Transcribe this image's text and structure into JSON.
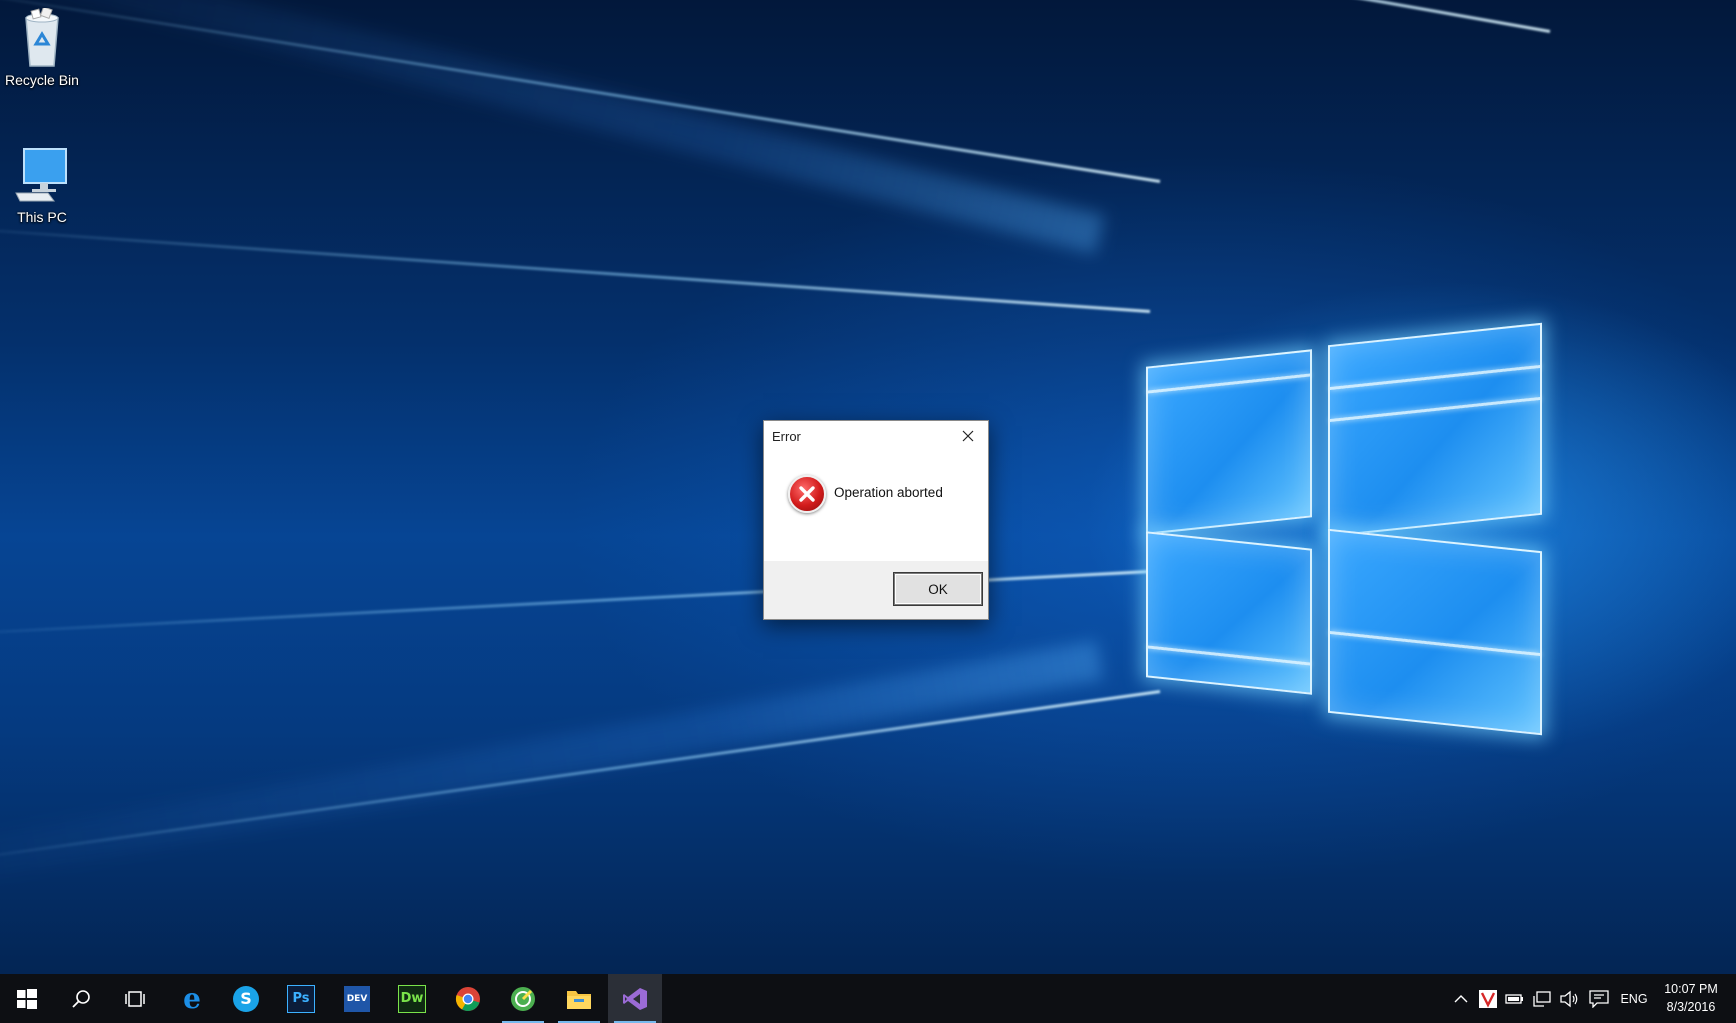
{
  "desktop": {
    "icons": [
      {
        "label": "Recycle Bin",
        "icon": "recycle-bin-icon"
      },
      {
        "label": "This PC",
        "icon": "this-pc-icon"
      }
    ]
  },
  "dialog": {
    "title": "Error",
    "message": "Operation aborted",
    "ok_label": "OK",
    "icon": "error-icon"
  },
  "taskbar": {
    "pinned_apps": [
      {
        "name": "start",
        "icon": "windows-start-icon"
      },
      {
        "name": "search",
        "icon": "search-icon"
      },
      {
        "name": "task-view",
        "icon": "task-view-icon"
      },
      {
        "name": "edge",
        "icon": "edge-icon",
        "glyph": "e"
      },
      {
        "name": "skype",
        "icon": "skype-icon",
        "glyph": "S"
      },
      {
        "name": "photoshop",
        "icon": "photoshop-icon",
        "glyph": "Ps"
      },
      {
        "name": "dev",
        "icon": "dev-app-icon",
        "glyph": "DEV"
      },
      {
        "name": "dreamweaver",
        "icon": "dreamweaver-icon",
        "glyph": "Dw"
      },
      {
        "name": "chrome",
        "icon": "chrome-icon"
      },
      {
        "name": "app-green",
        "icon": "green-app-icon"
      },
      {
        "name": "file-explorer",
        "icon": "file-explorer-icon"
      },
      {
        "name": "visual-studio",
        "icon": "visual-studio-icon"
      }
    ],
    "tray": {
      "language": "ENG",
      "time": "10:07 PM",
      "date": "8/3/2016"
    }
  },
  "colors": {
    "taskbar_bg": "#0d0f13",
    "accent": "#76b9ed",
    "error_red": "#d21b1b"
  }
}
